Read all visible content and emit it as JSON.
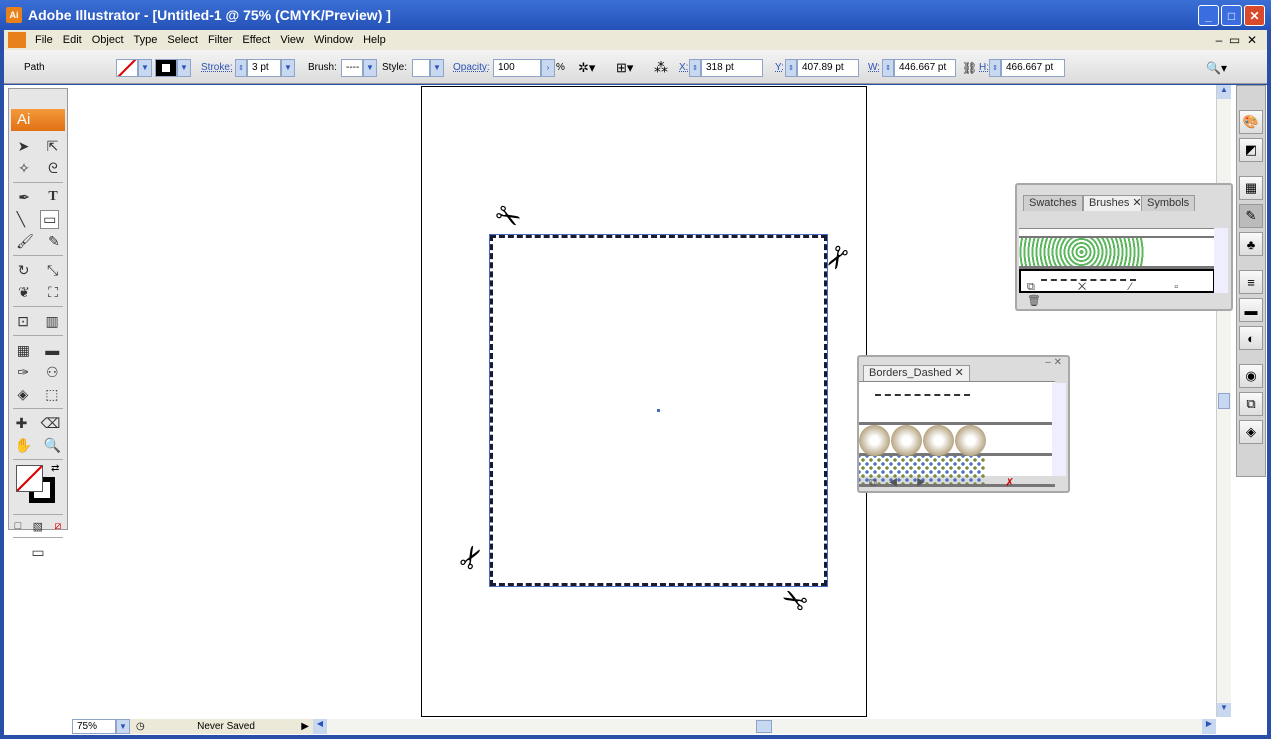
{
  "window": {
    "title": "Adobe Illustrator - [Untitled-1 @ 75% (CMYK/Preview) ]",
    "app_icon": "Ai",
    "buttons": [
      "minimize",
      "maximize",
      "close"
    ]
  },
  "menu": {
    "items": [
      "File",
      "Edit",
      "Object",
      "Type",
      "Select",
      "Filter",
      "Effect",
      "View",
      "Window",
      "Help"
    ]
  },
  "control": {
    "selection": "Path",
    "stroke_label": "Stroke:",
    "stroke_value": "3 pt",
    "brush_label": "Brush:",
    "style_label": "Style:",
    "opacity_label": "Opacity:",
    "opacity_value": "100",
    "percent": "%",
    "x_label": "X:",
    "x_value": "318 pt",
    "y_label": "Y:",
    "y_value": "407.89 pt",
    "w_label": "W:",
    "w_value": "446.667 pt",
    "h_label": "H:",
    "h_value": "466.667 pt"
  },
  "toolbox": {
    "header": "Ai"
  },
  "status": {
    "zoom": "75%",
    "save_state": "Never Saved"
  },
  "brushes_panel": {
    "tabs": [
      "Swatches",
      "Brushes",
      "Symbols"
    ],
    "active": "Brushes"
  },
  "borders_panel": {
    "tabs": [
      "Borders_Dashed"
    ]
  },
  "colors": {
    "accent": "#2452b8",
    "toolbox_header": "#e27014",
    "green_brush": "#5cb85c"
  }
}
